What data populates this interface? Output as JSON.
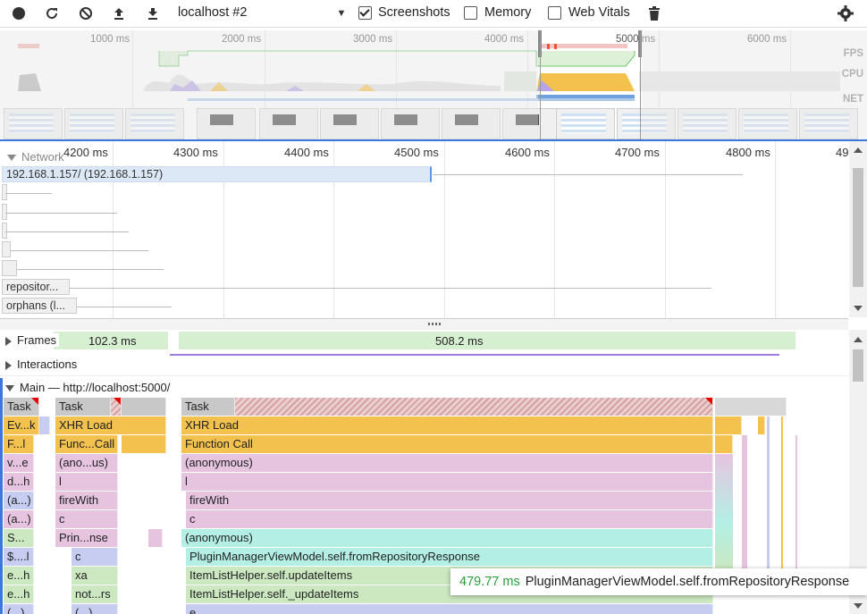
{
  "toolbar": {
    "target": "localhost #2",
    "options": {
      "screenshots": {
        "label": "Screenshots",
        "checked": true
      },
      "memory": {
        "label": "Memory",
        "checked": false
      },
      "web_vitals": {
        "label": "Web Vitals",
        "checked": false
      }
    }
  },
  "overview": {
    "ticks": [
      "1000 ms",
      "2000 ms",
      "3000 ms",
      "4000 ms",
      "5000 ms",
      "6000 ms"
    ],
    "tracks": {
      "fps": "FPS",
      "cpu": "CPU",
      "net": "NET"
    }
  },
  "ruler": [
    "4200 ms",
    "4300 ms",
    "4400 ms",
    "4500 ms",
    "4600 ms",
    "4700 ms",
    "4800 ms",
    "49"
  ],
  "network": {
    "title": "Network",
    "rows": [
      {
        "label": "192.168.1.157/ (192.168.1.157)"
      },
      {
        "label": ""
      },
      {
        "label": ""
      },
      {
        "label": ""
      },
      {
        "label": ""
      },
      {
        "label": ""
      },
      {
        "label": "repositor..."
      },
      {
        "label": "orphans (l..."
      }
    ]
  },
  "frames": {
    "title": "Frames",
    "first": "102.3 ms",
    "second": "508.2 ms"
  },
  "interactions": {
    "title": "Interactions"
  },
  "main": {
    "title": "Main — http://localhost:5000/"
  },
  "flame": {
    "col1": [
      "Task",
      "Ev...k",
      "F...l",
      "v...e",
      "d...h",
      "(a...)",
      "(a...)",
      "S...",
      "$....l",
      "e...h",
      "e...h",
      "(...)"
    ],
    "col2": [
      "Task",
      "XHR Load",
      "Func...Call",
      "(ano...us)",
      "l",
      "fireWith",
      "c",
      "Prin...nse",
      "c",
      "xa",
      "not...rs",
      "(...)"
    ],
    "col3": [
      "Task",
      "XHR Load",
      "Function Call",
      "(anonymous)",
      "l",
      "fireWith",
      "c",
      "(anonymous)",
      "PluginManagerViewModel.self.fromRepositoryResponse",
      "ItemListHelper.self.updateItems",
      "ItemListHelper.self._updateItems",
      "e"
    ]
  },
  "tooltip": {
    "duration": "479.77 ms",
    "name": "PluginManagerViewModel.self.fromRepositoryResponse"
  }
}
